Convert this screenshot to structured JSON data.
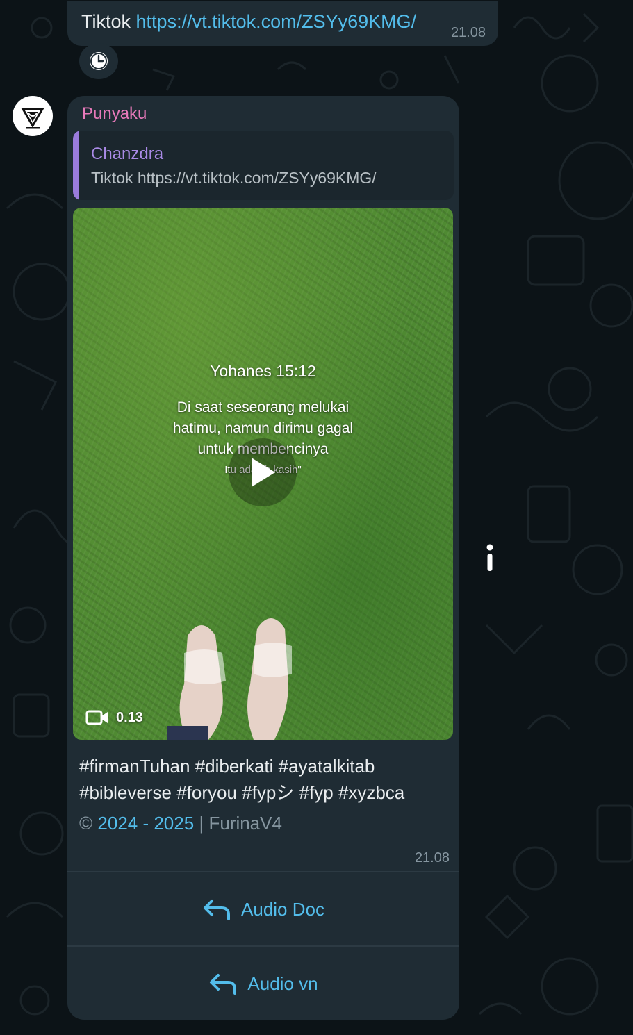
{
  "colors": {
    "chat_background": "#0c1317",
    "bubble": "#1f2c34",
    "link": "#53bdeb",
    "sender_name": "#e77aba",
    "quote_bar": "#9a7bdc",
    "timestamp": "#8696a0"
  },
  "top_message": {
    "text_prefix": "Tiktok",
    "link": "https://vt.tiktok.com/ZSYy69KMG/",
    "time": "21.08",
    "status_icon": "clock-icon"
  },
  "bot_message": {
    "avatar_icon": "bot-logo-icon",
    "sender": "Punyaku",
    "quoted": {
      "name": "Chanzdra",
      "text": "Tiktok https://vt.tiktok.com/ZSYy69KMG/"
    },
    "video": {
      "overlay_title": "Yohanes 15:12",
      "overlay_line1": "Di saat seseorang melukai",
      "overlay_line2": "hatimu, namun dirimu gagal",
      "overlay_line3": "untuk membencinya",
      "overlay_line4": "Itu adalah kasih\"",
      "duration": "0.13",
      "play_icon": "play-icon",
      "video_icon": "video-camera-icon"
    },
    "caption_line1": "#firmanTuhan #diberkati #ayatalkitab",
    "caption_line2": "#bibleverse #foryou #fypシ #fyp #xyzbca",
    "copyright_symbol": "©",
    "copyright_years": "2024 - 2025",
    "copyright_sep": "|",
    "copyright_name": "FurinaV4",
    "time": "21.08",
    "buttons": [
      {
        "label": "Audio Doc",
        "icon": "reply-arrow-icon"
      },
      {
        "label": "Audio vn",
        "icon": "reply-arrow-icon"
      }
    ]
  },
  "side_icon": "info-icon"
}
